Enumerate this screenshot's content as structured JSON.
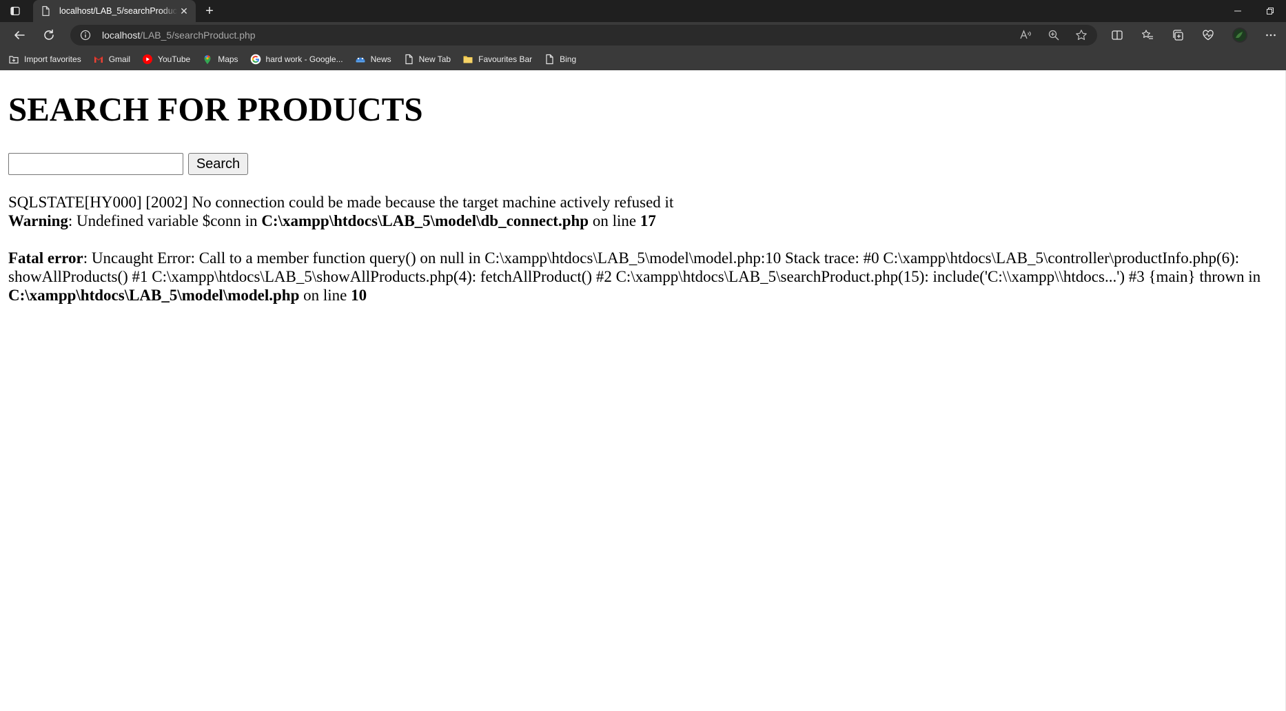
{
  "browser": {
    "tab": {
      "title": "localhost/LAB_5/searchProduct.php"
    },
    "address": {
      "host": "localhost",
      "path": "/LAB_5/searchProduct.php"
    },
    "favorites": [
      {
        "label": "Import favorites",
        "icon": "import-icon"
      },
      {
        "label": "Gmail",
        "icon": "gmail-icon"
      },
      {
        "label": "YouTube",
        "icon": "youtube-icon"
      },
      {
        "label": "Maps",
        "icon": "maps-icon"
      },
      {
        "label": "hard work - Google...",
        "icon": "google-icon"
      },
      {
        "label": "News",
        "icon": "news-icon"
      },
      {
        "label": "New Tab",
        "icon": "page-icon"
      },
      {
        "label": "Favourites Bar",
        "icon": "folder-icon"
      },
      {
        "label": "Bing",
        "icon": "page-icon"
      }
    ]
  },
  "page": {
    "title": "SEARCH FOR PRODUCTS",
    "search": {
      "value": "",
      "button_label": "Search"
    },
    "sql_error": "SQLSTATE[HY000] [2002] No connection could be made because the target machine actively refused it",
    "warning": {
      "label": "Warning",
      "text": ": Undefined variable $conn in ",
      "file": "C:\\xampp\\htdocs\\LAB_5\\model\\db_connect.php",
      "on_line": " on line ",
      "line": "17"
    },
    "fatal": {
      "label": "Fatal error",
      "text": ": Uncaught Error: Call to a member function query() on null in C:\\xampp\\htdocs\\LAB_5\\model\\model.php:10 Stack trace: #0 C:\\xampp\\htdocs\\LAB_5\\controller\\productInfo.php(6): showAllProducts() #1 C:\\xampp\\htdocs\\LAB_5\\showAllProducts.php(4): fetchAllProduct() #2 C:\\xampp\\htdocs\\LAB_5\\searchProduct.php(15): include('C:\\\\xampp\\\\htdocs...') #3 {main} thrown in ",
      "file": "C:\\xampp\\htdocs\\LAB_5\\model\\model.php",
      "on_line": " on line ",
      "line": "10"
    }
  }
}
